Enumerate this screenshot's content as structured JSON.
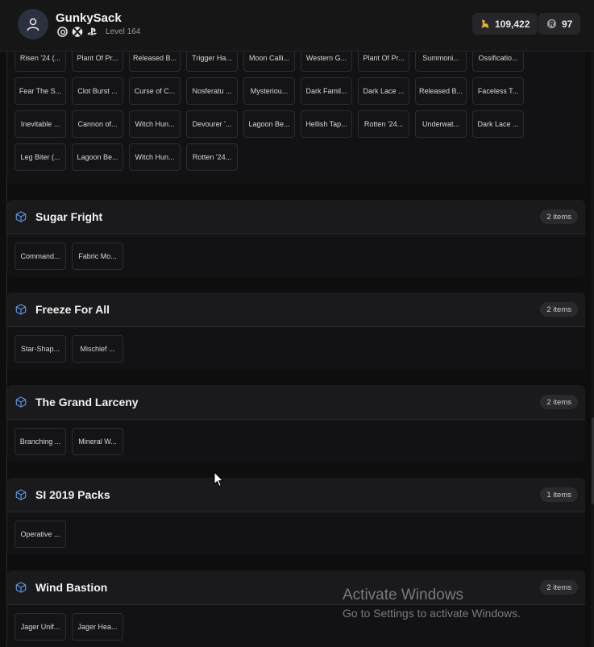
{
  "header": {
    "username": "GunkySack",
    "level": "Level 164",
    "platforms": [
      "ubisoft-icon",
      "xbox-icon",
      "playstation-icon"
    ],
    "renown": "109,422",
    "credits": "97"
  },
  "top_group": {
    "rows": [
      [
        "Risen '24 (...",
        "Plant Of Pr...",
        "Released B...",
        "Trigger Ha...",
        "Moon Calli...",
        "Western G...",
        "Plant Of Pr...",
        "Summoni...",
        "Ossificatio...",
        "Fear The S..."
      ],
      [
        "Clot Burst ...",
        "Curse of C...",
        "Nosferatu ...",
        "Mysteriou...",
        "Dark Famil...",
        "Dark Lace ...",
        "Released B...",
        "Faceless T...",
        "Inevitable ...",
        "Cannon of..."
      ],
      [
        "Witch Hun...",
        "Devourer '...",
        "Lagoon Be...",
        "Hellish Tap...",
        "Rotten '24...",
        "Underwat...",
        "Dark Lace ...",
        "Leg Biter (...",
        "Lagoon Be...",
        "Witch Hun..."
      ],
      [
        "Rotten '24..."
      ]
    ]
  },
  "packs": [
    {
      "title": "Sugar Fright",
      "count": "2 items",
      "items": [
        "Command...",
        "Fabric Mo..."
      ]
    },
    {
      "title": "Freeze For All",
      "count": "2 items",
      "items": [
        "Star-Shap...",
        "Mischief ..."
      ]
    },
    {
      "title": "The Grand Larceny",
      "count": "2 items",
      "items": [
        "Branching ...",
        "Mineral W..."
      ]
    },
    {
      "title": "SI 2019 Packs",
      "count": "1 items",
      "items": [
        "Operative ..."
      ]
    },
    {
      "title": "Wind Bastion",
      "count": "2 items",
      "items": [
        "Jager Unif...",
        "Jager Hea..."
      ]
    }
  ],
  "watermark": {
    "line1": "Activate Windows",
    "line2": "Go to Settings to activate Windows."
  },
  "colors": {
    "accent": "#5b8fd6",
    "renown": "#e2b72e"
  }
}
